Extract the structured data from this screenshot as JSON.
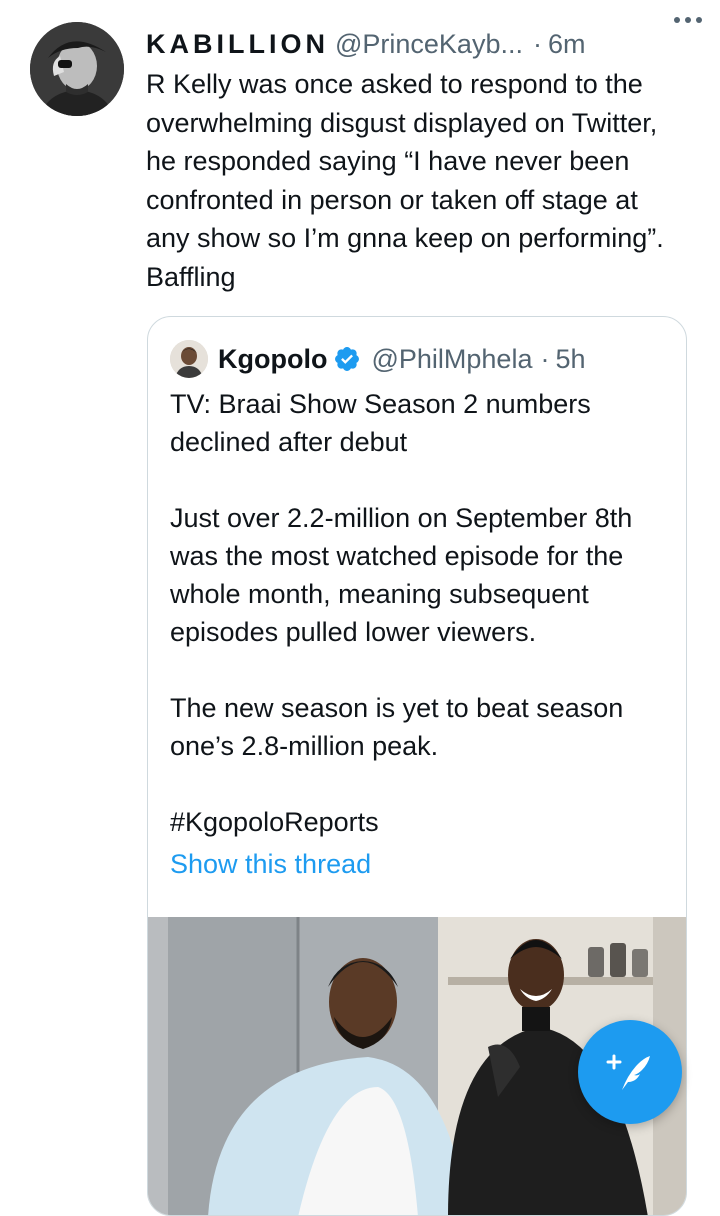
{
  "tweet": {
    "display_name": "KABILLION",
    "handle": "@PrinceKayb...",
    "separator": "·",
    "time": "6m",
    "text": "R Kelly was once asked to respond to the\noverwhelming disgust displayed on Twitter,\nhe responded saying “I have never been\nconfronted in person or taken off stage at\nany show so I’m gnna keep on performing”.\nBaffling"
  },
  "quoted_tweet": {
    "display_name": "Kgopolo",
    "handle": "@PhilMphela",
    "separator": "·",
    "time": "5h",
    "text": "TV: Braai Show Season 2 numbers\ndeclined after debut\n\nJust over 2.2-million on September 8th\nwas the most watched episode for the\nwhole month, meaning subsequent\nepisodes pulled lower viewers.\n\nThe new season is yet to beat season\none’s 2.8-million peak.\n\n#KgopoloReports",
    "show_thread_label": "Show this thread",
    "media_icon": "photo"
  },
  "icons": {
    "more": "more-horizontal-icon",
    "verified": "verified-badge-icon",
    "compose": "compose-tweet-icon"
  },
  "colors": {
    "accent": "#1d9bf0",
    "text_primary": "#0f1419",
    "text_secondary": "#536471",
    "border": "#cfd9de"
  }
}
